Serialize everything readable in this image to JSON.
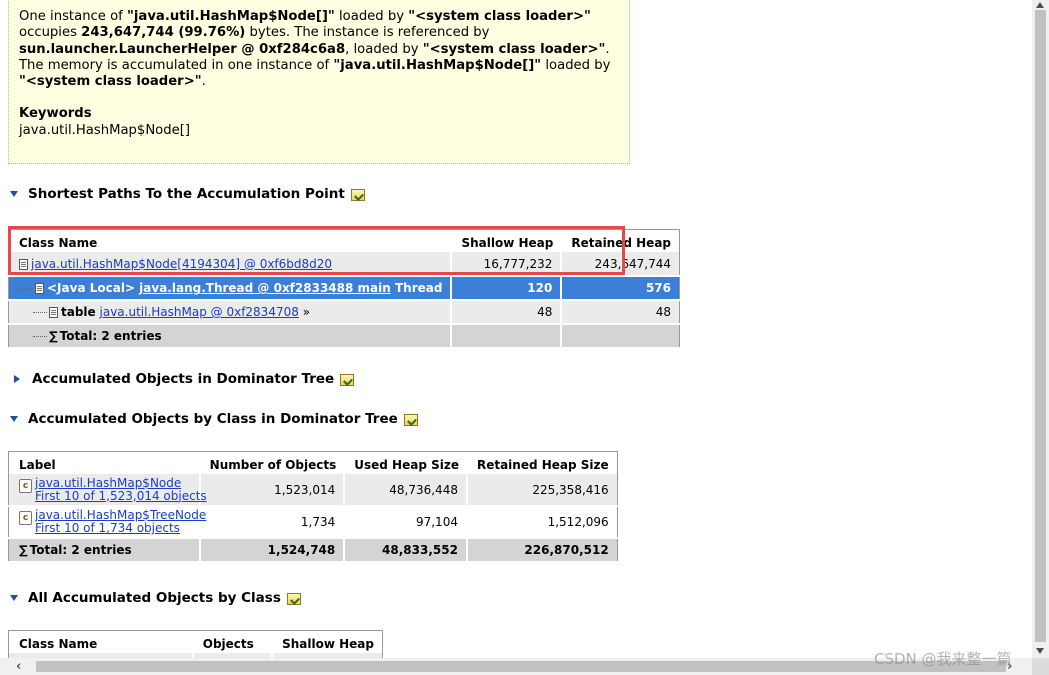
{
  "description": {
    "p1": "One instance of",
    "p1_class": "\"java.util.HashMap$Node[]\"",
    "p1b": "loaded by",
    "loader": "\"<system class loader>\"",
    "p2": "occupies",
    "size": "243,647,744 (99.76%)",
    "p3": "bytes. The instance is referenced by",
    "ref": "sun.launcher.LauncherHelper @ 0xf284c6a8",
    "p4": ", loaded by",
    "loader2": "\"<system class loader>\"",
    "p5": ". The memory is accumulated in one instance of",
    "p5_class": "\"java.util.HashMap$Node[]\"",
    "p6": "loaded by",
    "loader3": "\"<system class loader>\"",
    "p7": ".",
    "keywords_title": "Keywords",
    "keywords": "java.util.HashMap$Node[]"
  },
  "sections": {
    "shortest_paths": "Shortest Paths To the Accumulation Point",
    "dominator_tree": "Accumulated Objects in Dominator Tree",
    "by_class_dominator": "Accumulated Objects by Class in Dominator Tree",
    "all_by_class": "All Accumulated Objects by Class"
  },
  "paths_table": {
    "headers": [
      "Class Name",
      "Shallow Heap",
      "Retained Heap"
    ],
    "rows": [
      {
        "name": "java.util.HashMap$Node[4194304] @ 0xf6bd8d20",
        "shallow": "16,777,232",
        "retained": "243,647,744"
      },
      {
        "prefix": "<Java Local>",
        "name": "java.lang.Thread @ 0xf2833488 main",
        "suffix": "Thread",
        "shallow": "120",
        "retained": "576"
      },
      {
        "prefix": "table",
        "name": "java.util.HashMap @ 0xf2834708",
        "suffix": "»",
        "shallow": "48",
        "retained": "48"
      }
    ],
    "total": "Total: 2 entries"
  },
  "class_table": {
    "headers": [
      "Label",
      "Number of Objects",
      "Used Heap Size",
      "Retained Heap Size"
    ],
    "rows": [
      {
        "name": "java.util.HashMap$Node",
        "sub": "First 10 of 1,523,014 objects",
        "count": "1,523,014",
        "used": "48,736,448",
        "retained": "225,358,416"
      },
      {
        "name": "java.util.HashMap$TreeNode",
        "sub": "First 10 of 1,734 objects",
        "count": "1,734",
        "used": "97,104",
        "retained": "1,512,096"
      }
    ],
    "total": {
      "label": "Total: 2 entries",
      "count": "1,524,748",
      "used": "48,833,552",
      "retained": "226,870,512"
    }
  },
  "all_table": {
    "headers": [
      "Class Name",
      "Objects",
      "Shallow Heap"
    ]
  },
  "watermark": "CSDN @我来整一篇"
}
